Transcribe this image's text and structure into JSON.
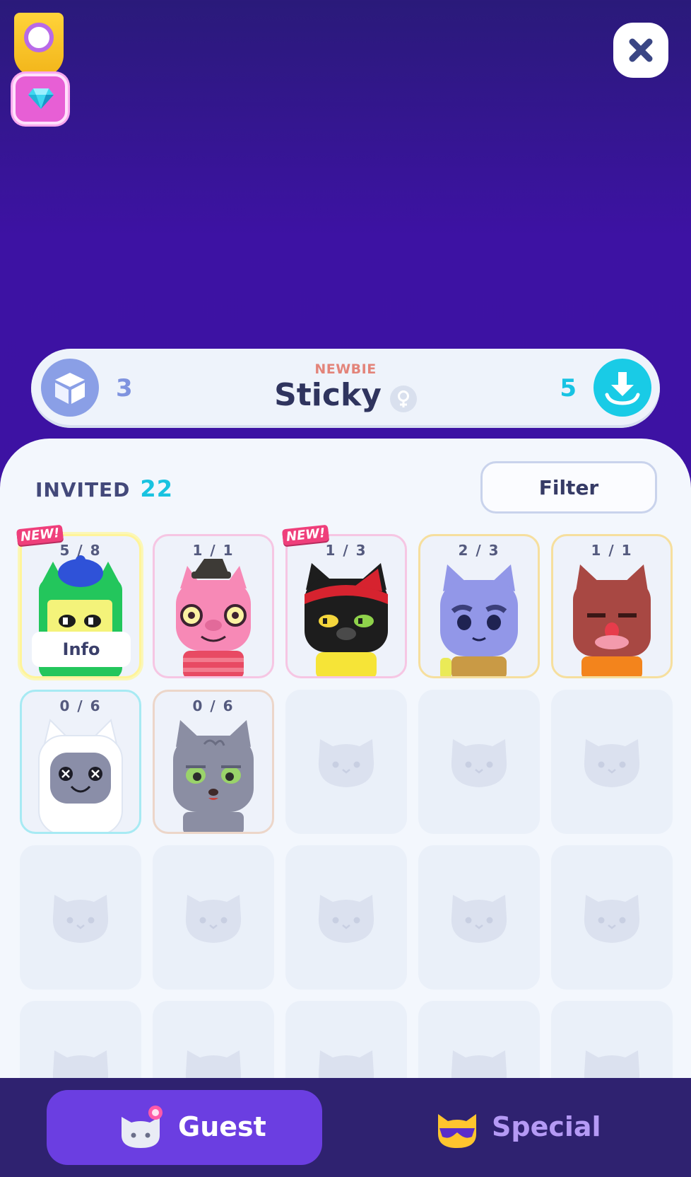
{
  "profile": {
    "rank": "NEWBIE",
    "name": "Sticky",
    "boxes_count": "3",
    "downloads_count": "5"
  },
  "panel": {
    "invited_label": "INVITED",
    "invited_count": "22",
    "filter_label": "Filter",
    "info_label": "Info",
    "new_tag": "NEW!"
  },
  "guests": [
    {
      "count": "5 / 8",
      "color": "#fff49a",
      "new": true
    },
    {
      "count": "1 / 1",
      "color": "#f6c6e3",
      "new": false
    },
    {
      "count": "1 / 3",
      "color": "#f6c6e3",
      "new": true
    },
    {
      "count": "2 / 3",
      "color": "#f6df9e",
      "new": false
    },
    {
      "count": "1 / 1",
      "color": "#f6df9e",
      "new": false
    },
    {
      "count": "0 / 6",
      "color": "#a7eaf3",
      "new": false
    },
    {
      "count": "0 / 6",
      "color": "#ecd6c9",
      "new": false
    }
  ],
  "tabs": {
    "guest_label": "Guest",
    "special_label": "Special"
  },
  "colors": {
    "background": "#3e13a2",
    "accent_cyan": "#19cbe6",
    "tab_active": "#6b3ee1",
    "tab_inactive_text": "#b59af5"
  }
}
